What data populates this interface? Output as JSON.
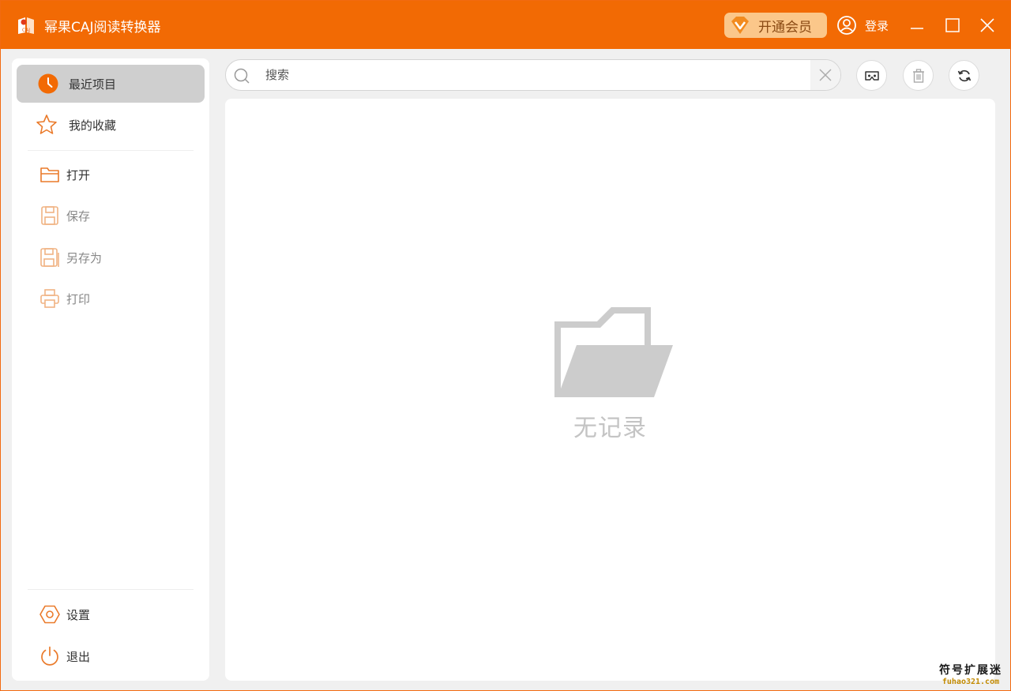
{
  "app": {
    "title": "幂果CAJ阅读转换器",
    "accent_color": "#f26a04"
  },
  "titlebar": {
    "vip_label": "开通会员",
    "login_label": "登录",
    "window_controls": [
      "minimize-icon",
      "maximize-icon",
      "close-icon"
    ]
  },
  "sidebar": {
    "top_items": [
      {
        "label": "最近项目",
        "icon": "clock-icon",
        "active": true
      },
      {
        "label": "我的收藏",
        "icon": "star-icon"
      }
    ],
    "file_items": [
      {
        "label": "打开",
        "icon": "folder-icon"
      },
      {
        "label": "保存",
        "icon": "save-icon",
        "disabled": true
      },
      {
        "label": "另存为",
        "icon": "save-as-icon",
        "disabled": true
      },
      {
        "label": "打印",
        "icon": "print-icon",
        "disabled": true
      }
    ],
    "bottom_items": [
      {
        "label": "设置",
        "icon": "settings-icon"
      },
      {
        "label": "退出",
        "icon": "power-icon"
      }
    ]
  },
  "search": {
    "placeholder": "搜索",
    "value": ""
  },
  "toolbar": {
    "buttons": [
      "vr-view-icon",
      "trash-icon",
      "refresh-icon"
    ]
  },
  "main": {
    "empty_text": "无记录"
  },
  "watermark": {
    "line1": "符号扩展迷",
    "line2": "fuhao321.com"
  }
}
